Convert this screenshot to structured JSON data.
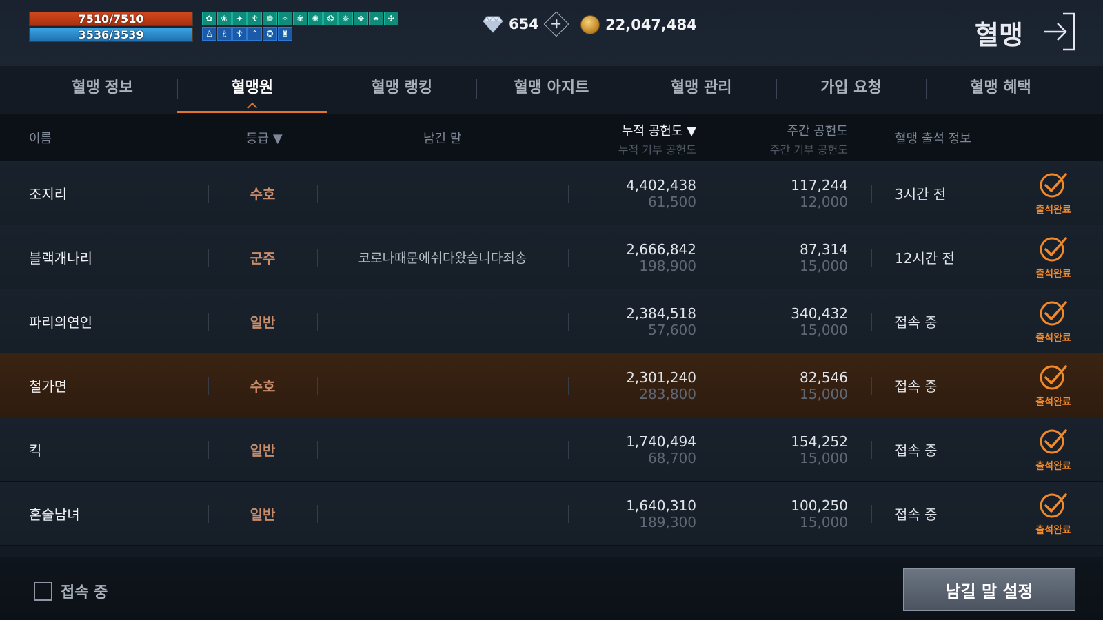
{
  "status": {
    "hp": {
      "text": "7510/7510",
      "fill": 1.0
    },
    "mp": {
      "text": "3536/3539",
      "fill": 0.999
    }
  },
  "buffs": {
    "row1": [
      "✿",
      "❀",
      "✦",
      "♆",
      "❁",
      "✧",
      "✾",
      "✺",
      "❂",
      "✵",
      "❖",
      "✷",
      "✣"
    ],
    "row2": [
      "♙",
      "♗",
      "♆",
      "⌃",
      "✪",
      "♜"
    ]
  },
  "currency": {
    "gems": "654",
    "gold": "22,047,484",
    "gem_icon": "diamond-icon",
    "gold_icon": "gold-coin-icon"
  },
  "header": {
    "title": "혈맹"
  },
  "tabs": [
    {
      "label": "혈맹 정보"
    },
    {
      "label": "혈맹원"
    },
    {
      "label": "혈맹 랭킹"
    },
    {
      "label": "혈맹 아지트"
    },
    {
      "label": "혈맹 관리"
    },
    {
      "label": "가입 요청"
    },
    {
      "label": "혈맹 혜택"
    }
  ],
  "active_tab": "혈맹원",
  "columns": {
    "name": "이름",
    "rank": "등급 ▼",
    "message": "남긴 말",
    "total": "누적 공헌도 ▼",
    "total_sub": "누적 기부 공헌도",
    "weekly": "주간 공헌도",
    "weekly_sub": "주간 기부 공헌도",
    "attendance": "혈맹 출석 정보"
  },
  "members": [
    {
      "name": "조지리",
      "rank": "수호",
      "message": "",
      "total": "4,402,438",
      "total_donation": "61,500",
      "weekly": "117,244",
      "weekly_donation": "12,000",
      "last_seen": "3시간 전",
      "check": "출석완료"
    },
    {
      "name": "블랙개나리",
      "rank": "군주",
      "message": "코로나때문에쉬다왔습니다죄송",
      "total": "2,666,842",
      "total_donation": "198,900",
      "weekly": "87,314",
      "weekly_donation": "15,000",
      "last_seen": "12시간 전",
      "check": "출석완료"
    },
    {
      "name": "파리의연인",
      "rank": "일반",
      "message": "",
      "total": "2,384,518",
      "total_donation": "57,600",
      "weekly": "340,432",
      "weekly_donation": "15,000",
      "last_seen": "접속 중",
      "check": "출석완료"
    },
    {
      "name": "철가면",
      "rank": "수호",
      "message": "",
      "total": "2,301,240",
      "total_donation": "283,800",
      "weekly": "82,546",
      "weekly_donation": "15,000",
      "last_seen": "접속 중",
      "check": "출석완료"
    },
    {
      "name": "킥",
      "rank": "일반",
      "message": "",
      "total": "1,740,494",
      "total_donation": "68,700",
      "weekly": "154,252",
      "weekly_donation": "15,000",
      "last_seen": "접속 중",
      "check": "출석완료"
    },
    {
      "name": "혼술남녀",
      "rank": "일반",
      "message": "",
      "total": "1,640,310",
      "total_donation": "189,300",
      "weekly": "100,250",
      "weekly_donation": "15,000",
      "last_seen": "접속 중",
      "check": "출석완료"
    }
  ],
  "highlighted_member": "철가면",
  "footer": {
    "online_filter_label": "접속 중",
    "online_filter_checked": false,
    "set_message_button": "남길 말 설정"
  },
  "colors": {
    "accent": "#e0742c",
    "attendance": "#f08a2c",
    "rank": "#c98c6b",
    "hp": "#c23a14",
    "mp": "#2a87cf"
  }
}
